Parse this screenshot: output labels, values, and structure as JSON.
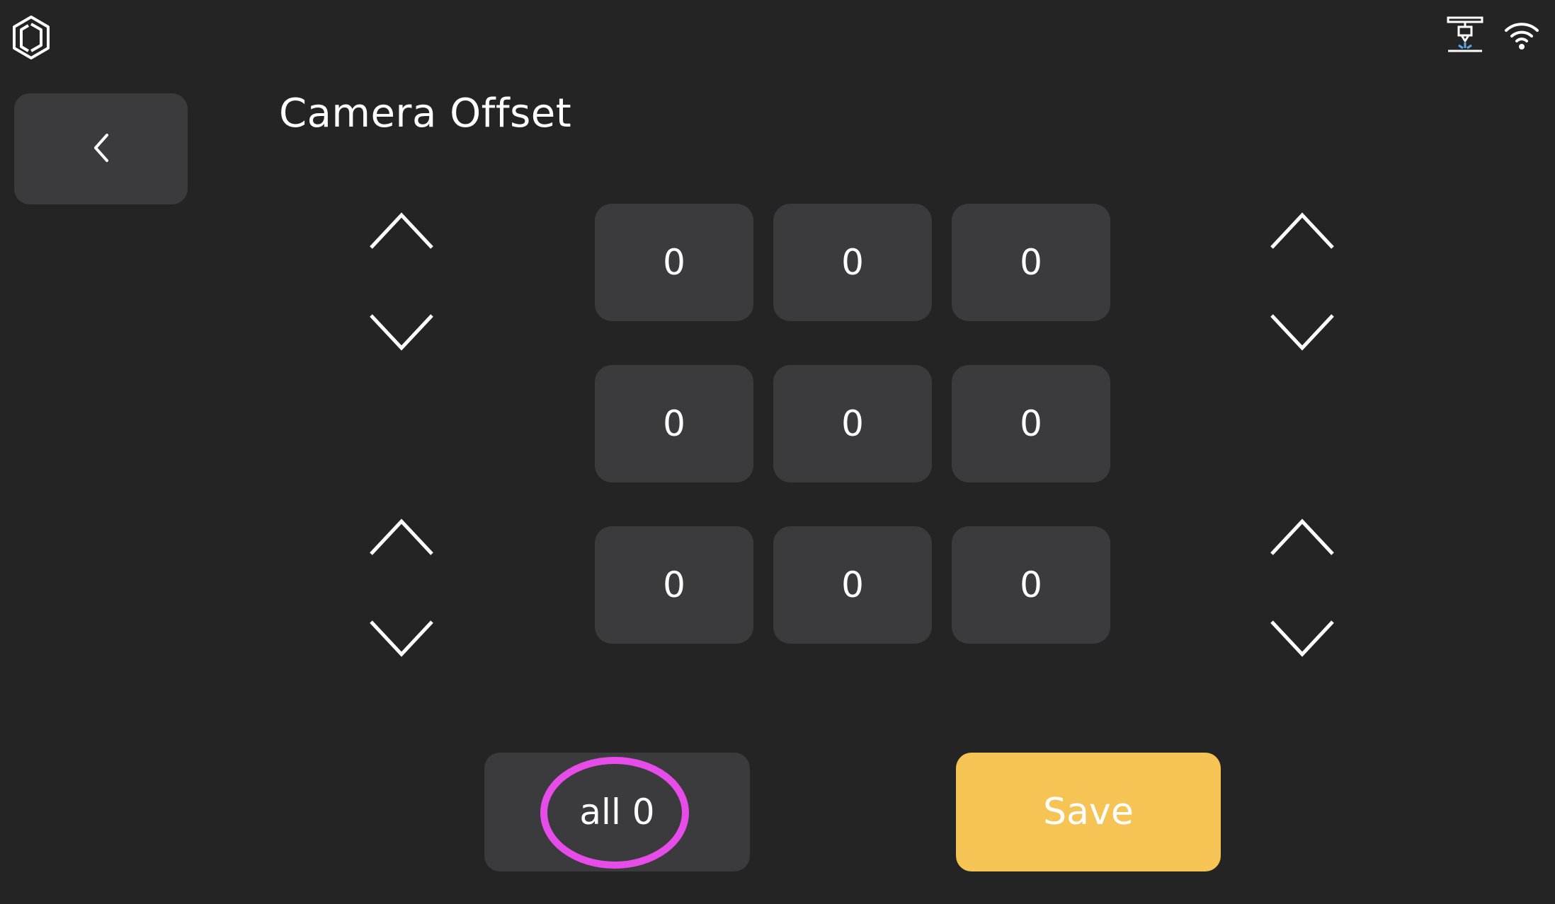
{
  "header": {
    "logo_icon": "hexagon-logo-icon",
    "status_icons": [
      "printer-nozzle-icon",
      "wifi-icon"
    ]
  },
  "page": {
    "title": "Camera Offset",
    "back_icon": "chevron-left-icon"
  },
  "grid": {
    "rows": [
      [
        "0",
        "0",
        "0"
      ],
      [
        "0",
        "0",
        "0"
      ],
      [
        "0",
        "0",
        "0"
      ]
    ]
  },
  "controls": {
    "up_icon": "chevron-up-icon",
    "down_icon": "chevron-down-icon"
  },
  "actions": {
    "all_zero_label": "all 0",
    "save_label": "Save"
  },
  "colors": {
    "background": "#242424",
    "tile": "#3b3b3d",
    "save": "#f5c455",
    "highlight": "#e64ce8"
  }
}
